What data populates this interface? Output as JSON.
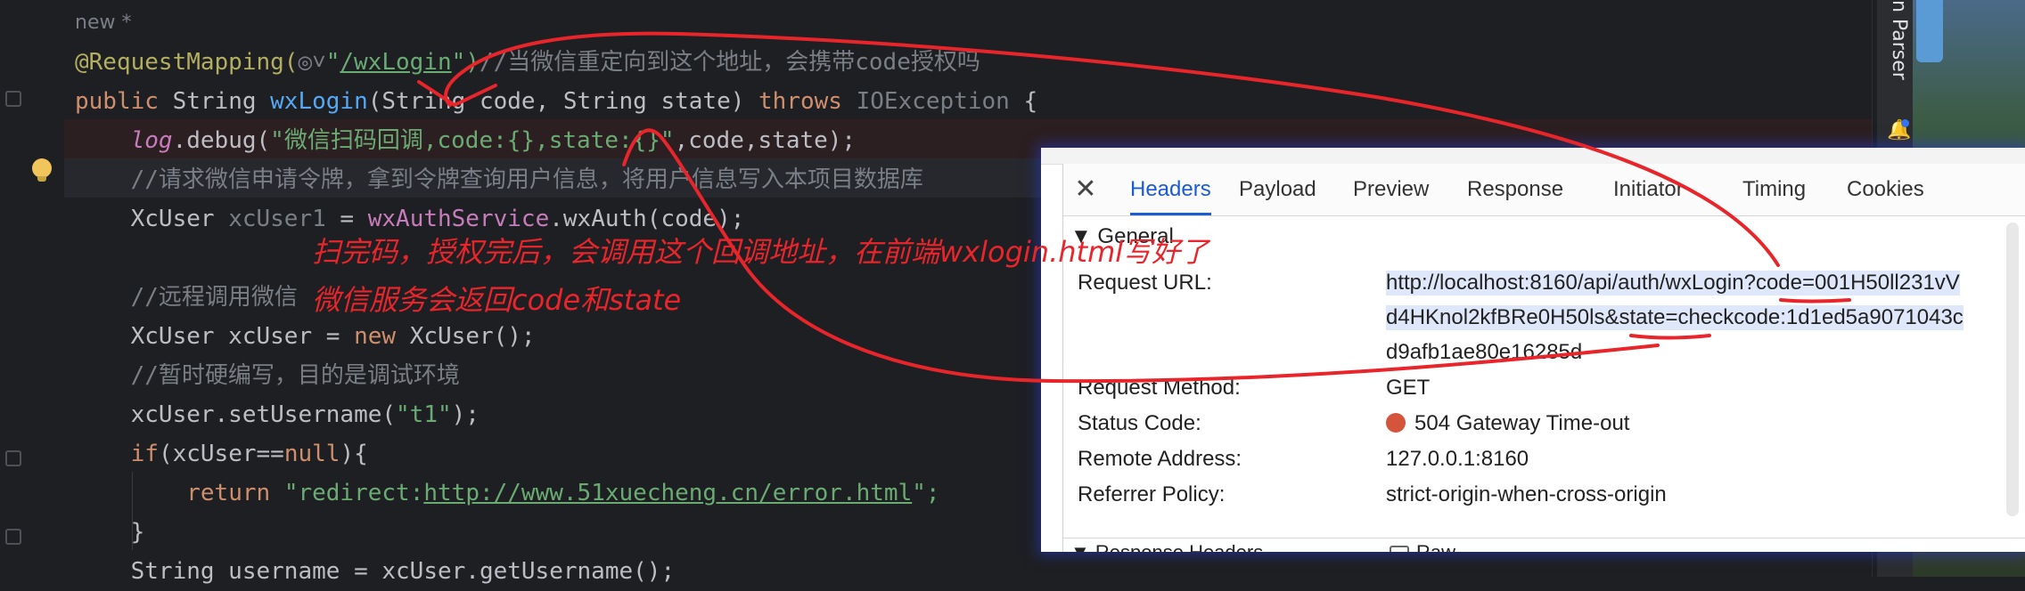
{
  "editor": {
    "lines": [
      {
        "id": "l0",
        "parts": [
          {
            "t": "new *",
            "c": "gray"
          }
        ]
      },
      {
        "id": "l1",
        "parts": [
          {
            "t": "@RequestMapping(",
            "c": "ann"
          },
          {
            "t": "◎˅",
            "c": "gray"
          },
          {
            "t": "\"",
            "c": "str"
          },
          {
            "t": "/wxLogin",
            "c": "str uline"
          },
          {
            "t": "\")",
            "c": "str"
          },
          {
            "t": "//当微信重定向到这个地址，会携带code授权吗",
            "c": "cmt"
          }
        ]
      },
      {
        "id": "l2",
        "parts": [
          {
            "t": "public ",
            "c": "kw"
          },
          {
            "t": "String ",
            "c": ""
          },
          {
            "t": "wxLogin",
            "c": "fn"
          },
          {
            "t": "(String code, String state) ",
            "c": ""
          },
          {
            "t": "throws ",
            "c": "kw"
          },
          {
            "t": "IOException",
            "c": "gray"
          },
          {
            "t": " {",
            "c": ""
          }
        ]
      },
      {
        "id": "l3",
        "parts": [
          {
            "t": "    ",
            "c": ""
          },
          {
            "t": "log",
            "c": "var ital"
          },
          {
            "t": ".debug(",
            "c": ""
          },
          {
            "t": "\"微信扫码回调,code:{},state:{}\"",
            "c": "str"
          },
          {
            "t": ",code,state);",
            "c": ""
          }
        ]
      },
      {
        "id": "l4",
        "parts": [
          {
            "t": "    //请求微信申请令牌，拿到令牌查询用户信息，将用户信息写入本项目数据库",
            "c": "cmt"
          }
        ]
      },
      {
        "id": "l5",
        "parts": [
          {
            "t": "    XcUser ",
            "c": ""
          },
          {
            "t": "xcUser1",
            "c": "gray"
          },
          {
            "t": " = ",
            "c": ""
          },
          {
            "t": "wxAuthService",
            "c": "var"
          },
          {
            "t": ".wxAuth(code);",
            "c": ""
          }
        ]
      },
      {
        "id": "l6",
        "parts": [
          {
            "t": "",
            "c": ""
          }
        ]
      },
      {
        "id": "l7",
        "parts": [
          {
            "t": "    //远程调用微信",
            "c": "cmt"
          }
        ]
      },
      {
        "id": "l8",
        "parts": [
          {
            "t": "    XcUser xcUser = ",
            "c": ""
          },
          {
            "t": "new ",
            "c": "kw"
          },
          {
            "t": "XcUser();",
            "c": ""
          }
        ]
      },
      {
        "id": "l9",
        "parts": [
          {
            "t": "    //暂时硬编写，目的是调试环境",
            "c": "cmt"
          }
        ]
      },
      {
        "id": "l10",
        "parts": [
          {
            "t": "    xcUser.setUsername(",
            "c": ""
          },
          {
            "t": "\"t1\"",
            "c": "str"
          },
          {
            "t": ");",
            "c": ""
          }
        ]
      },
      {
        "id": "l11",
        "parts": [
          {
            "t": "    ",
            "c": ""
          },
          {
            "t": "if",
            "c": "kw"
          },
          {
            "t": "(xcUser==",
            "c": ""
          },
          {
            "t": "null",
            "c": "kw"
          },
          {
            "t": "){",
            "c": ""
          }
        ]
      },
      {
        "id": "l12",
        "parts": [
          {
            "t": "        ",
            "c": ""
          },
          {
            "t": "return ",
            "c": "kw"
          },
          {
            "t": "\"redirect:",
            "c": "str"
          },
          {
            "t": "http://www.51xuecheng.cn/error.html",
            "c": "str uline"
          },
          {
            "t": "\";",
            "c": "str"
          }
        ]
      },
      {
        "id": "l13",
        "parts": [
          {
            "t": "    }",
            "c": ""
          }
        ]
      },
      {
        "id": "l14",
        "parts": [
          {
            "t": "    String username = xcUser.getUsername();",
            "c": ""
          }
        ]
      }
    ]
  },
  "toolwindow": {
    "parser_label": "n Parser"
  },
  "annotations": {
    "line1": "扫完码，授权完后，会调用这个回调地址，在前端wxlogin.html写好了",
    "line2": "微信服务会返回code和state"
  },
  "devtools": {
    "tabs": [
      "Headers",
      "Payload",
      "Preview",
      "Response",
      "Initiator",
      "Timing",
      "Cookies"
    ],
    "active_tab": "Headers",
    "section": "▼ General",
    "request_url_label": "Request URL:",
    "request_url_lines": [
      "http://localhost:8160/api/auth/wxLogin?code=001H50ll231vV",
      "d4HKnol2kfBRe0H50ls&state=checkcode:1d1ed5a9071043c",
      "d9afb1ae80e16285d"
    ],
    "rows": [
      {
        "label": "Request Method:",
        "value": "GET"
      },
      {
        "label": "Status Code:",
        "value": "504 Gateway Time-out"
      },
      {
        "label": "Remote Address:",
        "value": "127.0.0.1:8160"
      },
      {
        "label": "Referrer Policy:",
        "value": "strict-origin-when-cross-origin"
      }
    ],
    "response_headers": "▼ Response Headers",
    "raw_label": "Raw",
    "status_color": "#d5543c"
  },
  "colors": {
    "ink": "#e8252b",
    "accent": "#1a5bd6"
  }
}
